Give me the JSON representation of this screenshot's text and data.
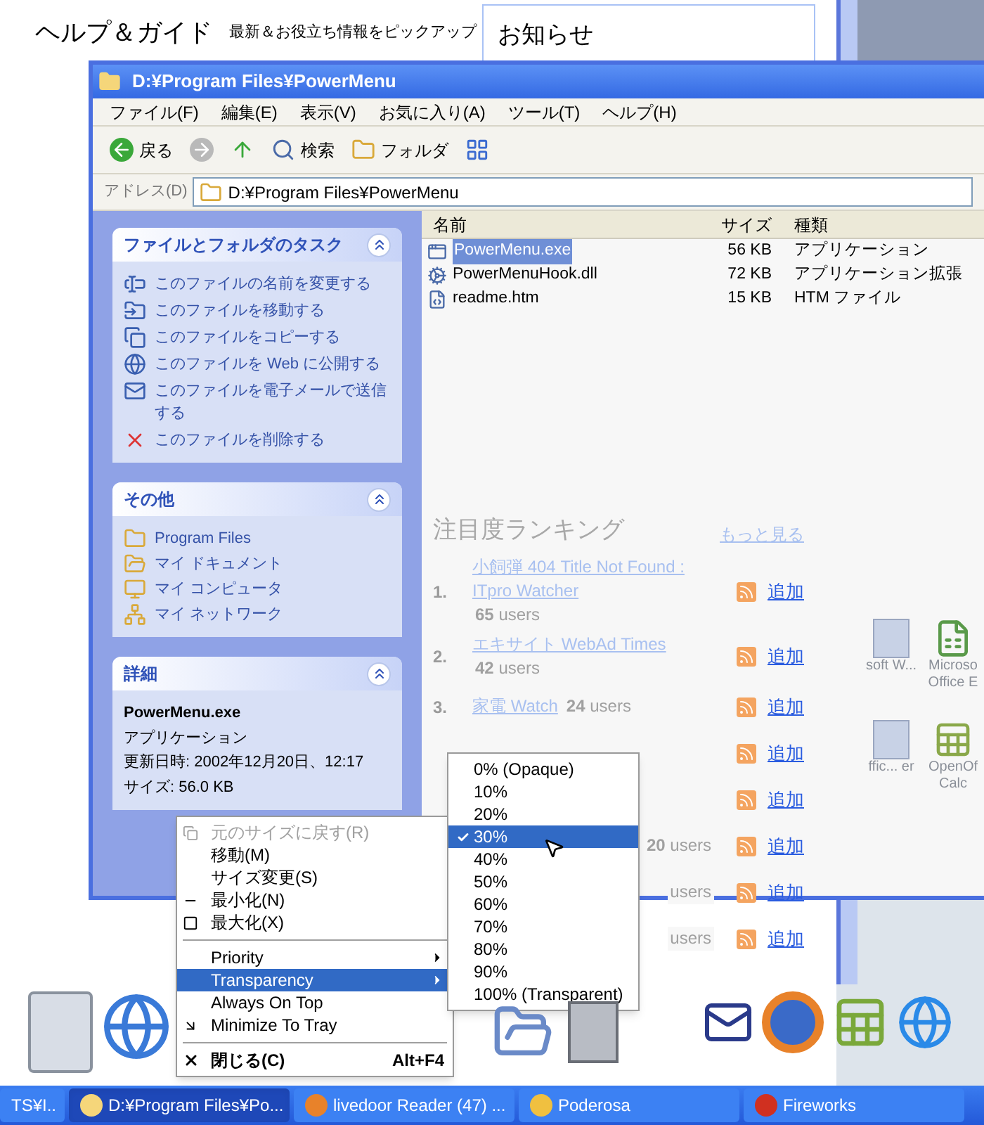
{
  "browser": {
    "heading": "ヘルプ＆ガイド",
    "subheading": "最新＆お役立ち情報をピックアップ",
    "notice_title": "お知らせ"
  },
  "explorer": {
    "title": "D:¥Program Files¥PowerMenu",
    "menu": [
      "ファイル(F)",
      "編集(E)",
      "表示(V)",
      "お気に入り(A)",
      "ツール(T)",
      "ヘルプ(H)"
    ],
    "toolbar": [
      {
        "kind": "back",
        "label": "戻る"
      },
      {
        "kind": "forward"
      },
      {
        "kind": "up"
      },
      {
        "kind": "search",
        "label": "検索"
      },
      {
        "kind": "folders",
        "label": "フォルダ"
      },
      {
        "kind": "views"
      }
    ],
    "address_label": "アドレス(D)",
    "address": "D:¥Program Files¥PowerMenu",
    "task_groups": [
      {
        "kind": "links",
        "title": "ファイルとフォルダのタスク",
        "expanded": true,
        "items": [
          "このファイルの名前を変更する",
          "このファイルを移動する",
          "このファイルをコピーする",
          "このファイルを Web に公開する",
          "このファイルを電子メールで送信する",
          "このファイルを削除する"
        ]
      },
      {
        "kind": "places",
        "title": "その他",
        "expanded": true,
        "items": [
          "Program Files",
          "マイ ドキュメント",
          "マイ コンピュータ",
          "マイ ネットワーク"
        ]
      },
      {
        "kind": "details",
        "title": "詳細",
        "expanded": true,
        "items": [
          "PowerMenu.exe",
          "アプリケーション",
          "更新日時: 2002年12月20日、12:17",
          "サイズ: 56.0 KB"
        ]
      }
    ],
    "columns": [
      "名前",
      "サイズ",
      "種類"
    ],
    "files": [
      {
        "name": "PowerMenu.exe",
        "size": "56 KB",
        "type": "アプリケーション",
        "selected": true
      },
      {
        "name": "PowerMenuHook.dll",
        "size": "72 KB",
        "type": "アプリケーション拡張",
        "selected": false
      },
      {
        "name": "readme.htm",
        "size": "15 KB",
        "type": "HTM ファイル",
        "selected": false
      }
    ]
  },
  "ranking": {
    "title": "注目度ランキング",
    "more": "もっと見る",
    "items": [
      {
        "rank": "1.",
        "title": "小飼弾 404 Title Not Found : ITpro Watcher",
        "users": "**65** users",
        "add": "追加"
      },
      {
        "rank": "2.",
        "title": "エキサイト WebAd Times",
        "users": "**42** users",
        "add": "追加"
      },
      {
        "rank": "3.",
        "title": "家電 Watch",
        "users": "**24** users",
        "add": "追加"
      },
      {
        "add": "追加"
      },
      {
        "add": "追加"
      },
      {
        "users": "**20** users",
        "add": "追加"
      },
      {
        "users": "users",
        "add": "追加"
      },
      {
        "users": "users",
        "add": "追加"
      }
    ]
  },
  "context_menu": [
    {
      "kind": "item",
      "label": "元のサイズに戻す(R)",
      "disabled": true,
      "selected": false,
      "submenu": false
    },
    {
      "kind": "item",
      "label": "移動(M)",
      "disabled": false,
      "selected": false,
      "submenu": false
    },
    {
      "kind": "item",
      "label": "サイズ変更(S)",
      "disabled": false,
      "selected": false,
      "submenu": false
    },
    {
      "kind": "item",
      "label": "最小化(N)",
      "disabled": false,
      "selected": false,
      "submenu": false
    },
    {
      "kind": "item",
      "label": "最大化(X)",
      "disabled": false,
      "selected": false,
      "submenu": false
    },
    {
      "kind": "separator"
    },
    {
      "kind": "item",
      "label": "Priority",
      "disabled": false,
      "selected": false,
      "submenu": true
    },
    {
      "kind": "item",
      "label": "Transparency",
      "disabled": false,
      "selected": true,
      "submenu": true
    },
    {
      "kind": "item",
      "label": "Always On Top",
      "disabled": false,
      "selected": false,
      "submenu": false
    },
    {
      "kind": "item",
      "label": "Minimize To Tray",
      "disabled": false,
      "selected": false,
      "submenu": false
    },
    {
      "kind": "separator"
    },
    {
      "kind": "item",
      "label": "閉じる(C)",
      "shortcut": "Alt+F4",
      "disabled": false,
      "selected": false,
      "submenu": false
    }
  ],
  "transparency_menu": [
    {
      "label": "0% (Opaque)",
      "checked": false,
      "selected": false
    },
    {
      "label": "10%",
      "checked": false,
      "selected": false
    },
    {
      "label": "20%",
      "checked": false,
      "selected": false
    },
    {
      "label": "30%",
      "checked": true,
      "selected": true
    },
    {
      "label": "40%",
      "checked": false,
      "selected": false
    },
    {
      "label": "50%",
      "checked": false,
      "selected": false
    },
    {
      "label": "60%",
      "checked": false,
      "selected": false
    },
    {
      "label": "70%",
      "checked": false,
      "selected": false
    },
    {
      "label": "80%",
      "checked": false,
      "selected": false
    },
    {
      "label": "90%",
      "checked": false,
      "selected": false
    },
    {
      "label": "100% (Transparent)",
      "checked": false,
      "selected": false
    }
  ],
  "desktop_icons": [
    {
      "label": "soft W..."
    },
    {
      "label": "Microso Office E"
    },
    {
      "label": "ffic... er"
    },
    {
      "label": "OpenOf Calc"
    }
  ],
  "taskbar": [
    {
      "label": "TS¥I..",
      "selected": false
    },
    {
      "label": "D:¥Program Files¥Po...",
      "selected": true
    },
    {
      "label": "livedoor Reader (47) ...",
      "selected": false
    },
    {
      "label": "Poderosa",
      "selected": false
    },
    {
      "label": "Fireworks",
      "selected": false
    }
  ]
}
